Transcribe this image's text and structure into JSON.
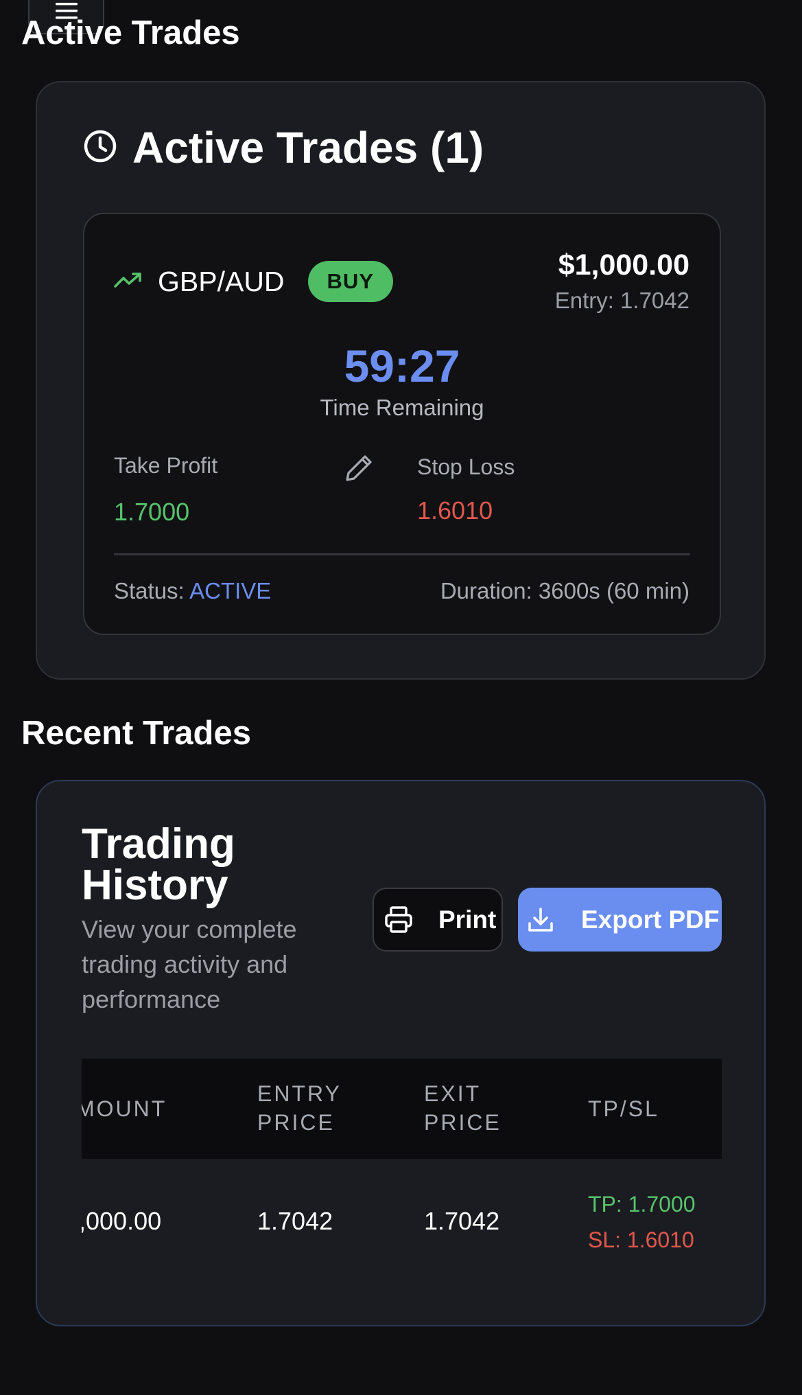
{
  "top": {
    "menu_icon": "hamburger-icon",
    "page_heading": "Active Trades"
  },
  "active_trades": {
    "header_icon": "clock-icon",
    "title": "Active Trades (1)",
    "trade": {
      "trend_icon": "trending-up-icon",
      "pair": "GBP/AUD",
      "side": "BUY",
      "amount": "$1,000.00",
      "entry": "Entry: 1.7042",
      "countdown": "59:27",
      "countdown_label": "Time Remaining",
      "take_profit_label": "Take Profit",
      "take_profit_value": "1.7000",
      "edit_icon": "pencil-icon",
      "stop_loss_label": "Stop Loss",
      "stop_loss_value": "1.6010",
      "status_label": "Status:",
      "status_value": "ACTIVE",
      "duration": "Duration: 3600s (60 min)"
    }
  },
  "recent": {
    "heading": "Recent Trades",
    "history": {
      "title": "Trading History",
      "subtitle": "View your complete trading activity and performance",
      "print_label": "Print",
      "print_icon": "printer-icon",
      "export_label": "Export PDF",
      "export_icon": "download-icon",
      "columns": [
        "MOUNT",
        "ENTRY PRICE",
        "EXIT PRICE",
        "TP/SL"
      ],
      "rows": [
        {
          "amount": ",000.00",
          "entry_price": "1.7042",
          "exit_price": "1.7042",
          "tp": "TP: 1.7000",
          "sl": "SL: 1.6010"
        }
      ]
    }
  },
  "colors": {
    "accent_blue": "#6b8ef0",
    "buy_green": "#4fbd63",
    "loss_red": "#e2574c",
    "background": "#0f0f12"
  }
}
